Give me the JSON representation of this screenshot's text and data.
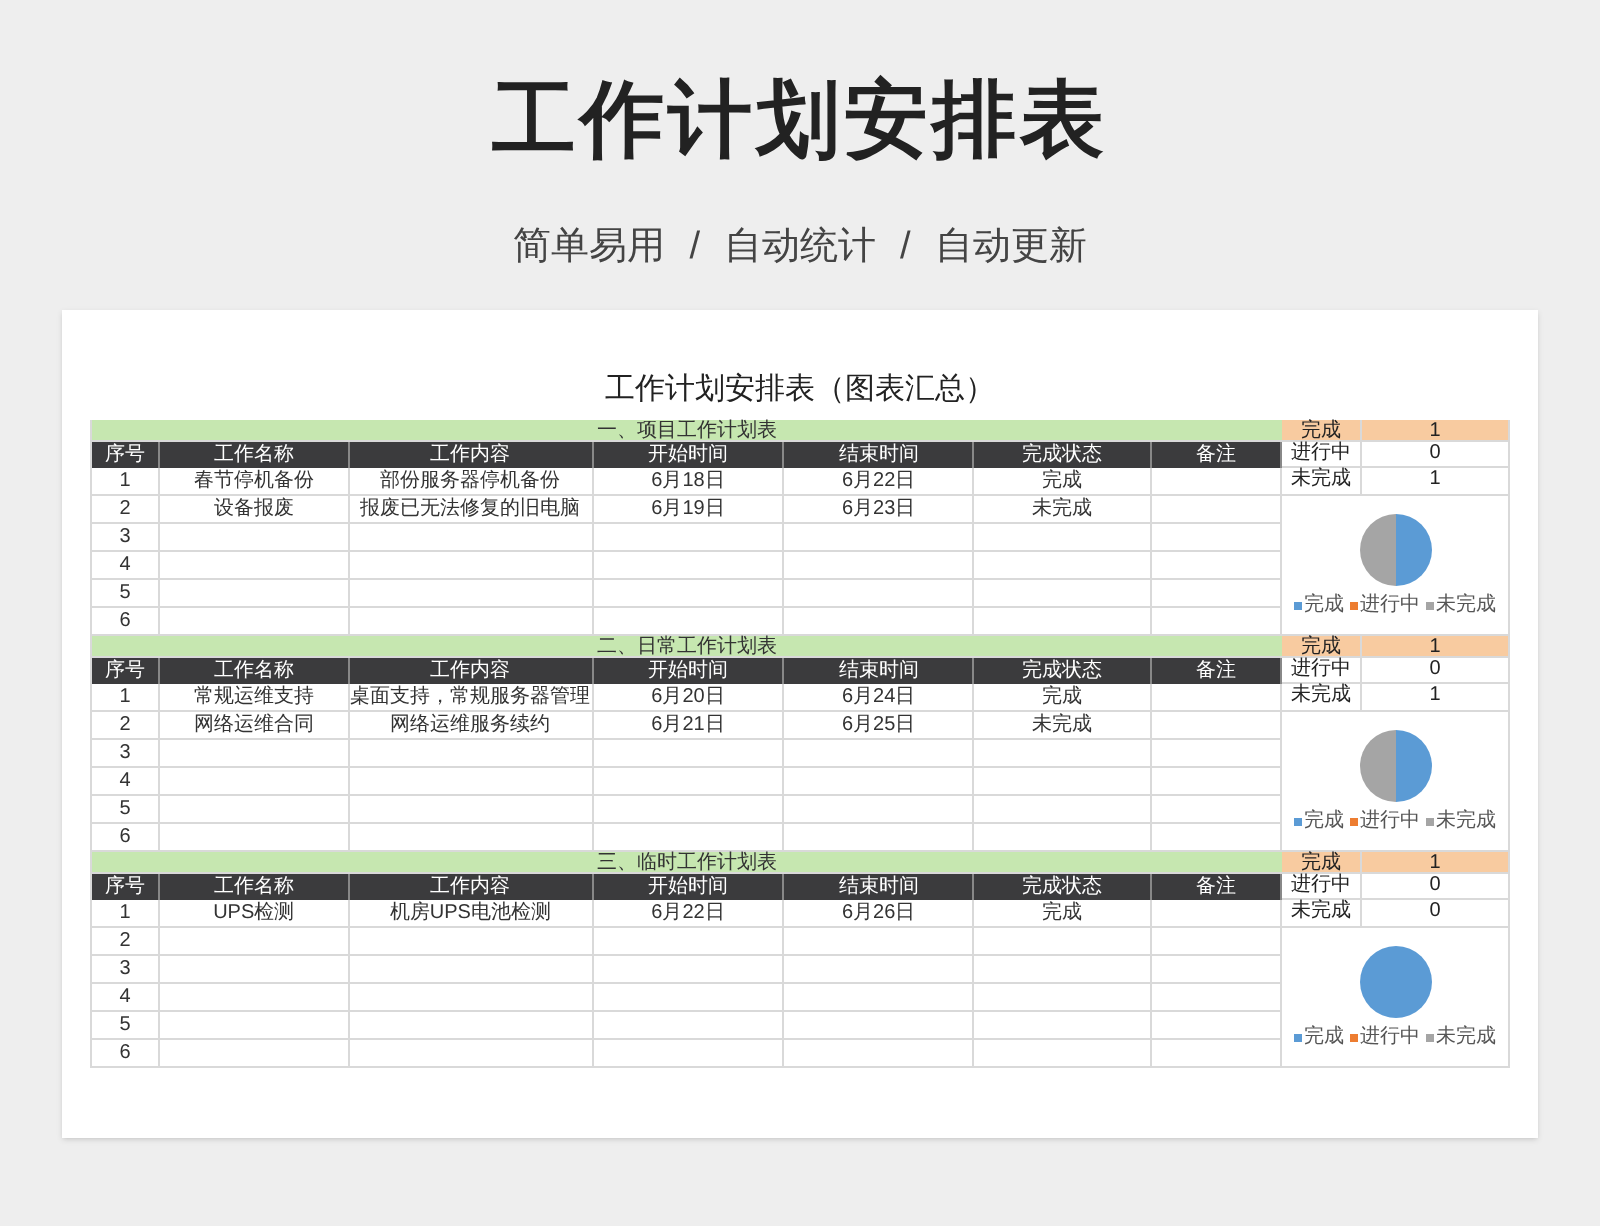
{
  "page": {
    "title": "工作计划安排表",
    "subtitle": [
      "简单易用",
      "/",
      "自动统计",
      "/",
      "自动更新"
    ]
  },
  "sheet": {
    "title": "工作计划安排表（图表汇总）",
    "sections": [
      {
        "heading": "一、项目工作计划表",
        "columns": [
          "序号",
          "工作名称",
          "工作内容",
          "开始时间",
          "结束时间",
          "完成状态",
          "备注"
        ],
        "rows": [
          {
            "cells": [
              "1",
              "春节停机备份",
              "部份服务器停机备份",
              "6月18日",
              "6月22日",
              "完成"
            ]
          },
          {
            "cells": [
              "2",
              "设备报废",
              "报废已无法修复的旧电脑",
              "6月19日",
              "6月23日",
              "未完成"
            ]
          },
          {
            "cells": [
              "3"
            ]
          },
          {
            "cells": [
              "4"
            ]
          },
          {
            "cells": [
              "5"
            ]
          },
          {
            "cells": [
              "6"
            ]
          }
        ],
        "summary": [
          {
            "label": "完成",
            "value": "1",
            "highlighted": true
          },
          {
            "label": "进行中",
            "value": "0",
            "highlighted": false
          },
          {
            "label": "未完成",
            "value": "1",
            "highlighted": false
          }
        ],
        "chart_data": {
          "type": "pie",
          "categories": [
            "完成",
            "进行中",
            "未完成"
          ],
          "values": [
            50,
            0,
            50
          ],
          "legend": "bottom"
        }
      },
      {
        "heading": "二、日常工作计划表",
        "columns": [
          "序号",
          "工作名称",
          "工作内容",
          "开始时间",
          "结束时间",
          "完成状态",
          "备注"
        ],
        "rows": [
          {
            "cells": [
              "1",
              "常规运维支持",
              "桌面支持，常规服务器管理",
              "6月20日",
              "6月24日",
              "完成"
            ]
          },
          {
            "cells": [
              "2",
              "网络运维合同",
              "网络运维服务续约",
              "6月21日",
              "6月25日",
              "未完成"
            ]
          },
          {
            "cells": [
              "3"
            ]
          },
          {
            "cells": [
              "4"
            ]
          },
          {
            "cells": [
              "5"
            ]
          },
          {
            "cells": [
              "6"
            ]
          }
        ],
        "summary": [
          {
            "label": "完成",
            "value": "1",
            "highlighted": true
          },
          {
            "label": "进行中",
            "value": "0",
            "highlighted": false
          },
          {
            "label": "未完成",
            "value": "1",
            "highlighted": false
          }
        ],
        "chart_data": {
          "type": "pie",
          "categories": [
            "完成",
            "进行中",
            "未完成"
          ],
          "values": [
            50,
            0,
            50
          ],
          "legend": "bottom"
        }
      },
      {
        "heading": "三、临时工作计划表",
        "columns": [
          "序号",
          "工作名称",
          "工作内容",
          "开始时间",
          "结束时间",
          "完成状态",
          "备注"
        ],
        "rows": [
          {
            "cells": [
              "1",
              "UPS检测",
              "机房UPS电池检测",
              "6月22日",
              "6月26日",
              "完成"
            ]
          },
          {
            "cells": [
              "2"
            ]
          },
          {
            "cells": [
              "3"
            ]
          },
          {
            "cells": [
              "4"
            ]
          },
          {
            "cells": [
              "5"
            ]
          },
          {
            "cells": [
              "6"
            ]
          }
        ],
        "summary": [
          {
            "label": "完成",
            "value": "1",
            "highlighted": true
          },
          {
            "label": "进行中",
            "value": "0",
            "highlighted": false
          },
          {
            "label": "未完成",
            "value": "0",
            "highlighted": false
          }
        ],
        "chart_data": {
          "type": "pie",
          "categories": [
            "完成",
            "进行中",
            "未完成"
          ],
          "values": [
            100,
            0,
            0
          ],
          "legend": "bottom"
        }
      }
    ]
  }
}
